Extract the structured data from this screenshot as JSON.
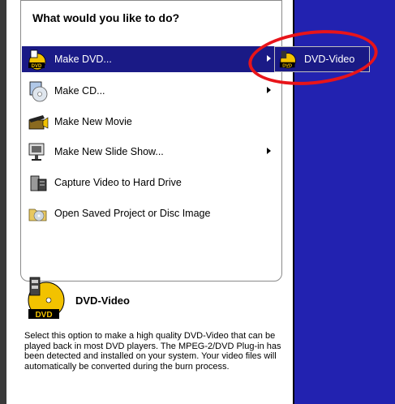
{
  "menu": {
    "title": "What would you like to do?",
    "items": [
      {
        "label": "Make DVD...",
        "icon": "dvd-disc-icon",
        "has_submenu": true,
        "selected": true
      },
      {
        "label": "Make CD...",
        "icon": "cd-disc-icon",
        "has_submenu": true,
        "selected": false
      },
      {
        "label": "Make New Movie",
        "icon": "movie-clapper-icon",
        "has_submenu": false,
        "selected": false
      },
      {
        "label": "Make New Slide Show...",
        "icon": "slideshow-icon",
        "has_submenu": true,
        "selected": false
      },
      {
        "label": "Capture Video to Hard Drive",
        "icon": "capture-video-icon",
        "has_submenu": false,
        "selected": false
      },
      {
        "label": "Open Saved Project or Disc Image",
        "icon": "open-folder-icon",
        "has_submenu": false,
        "selected": false
      }
    ]
  },
  "submenu": {
    "items": [
      {
        "label": "DVD-Video",
        "icon": "dvd-video-icon",
        "selected": true
      }
    ]
  },
  "info": {
    "title": "DVD-Video",
    "icon": "dvd-video-large-icon",
    "description": "Select this option to make a high quality DVD-Video that can be played back in most DVD players. The MPEG-2/DVD Plug-in has been detected and installed on your system. Your video files will automatically be converted during the burn process."
  },
  "colors": {
    "selection": "#1a1a86",
    "background_panel": "#2222b0",
    "highlight_ring": "#e8141a"
  }
}
